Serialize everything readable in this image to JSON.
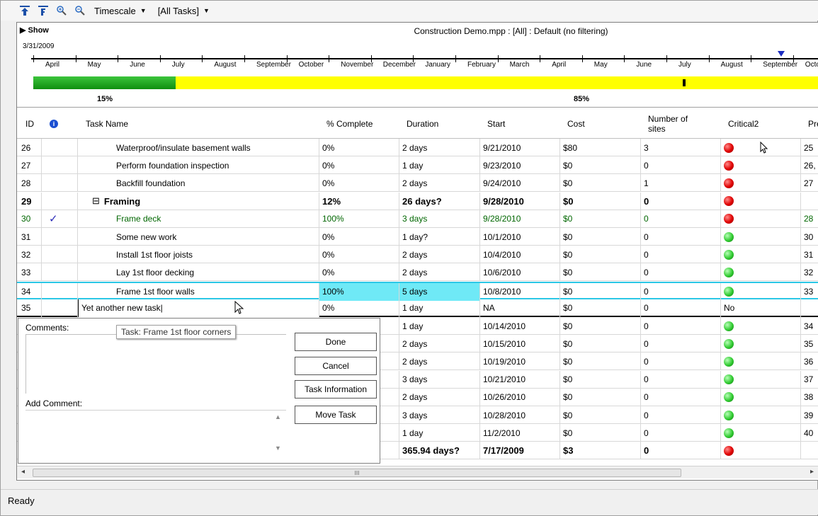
{
  "toolbar": {
    "timescale_label": "Timescale",
    "filter_label": "[All Tasks]"
  },
  "timeline": {
    "show_label": "Show",
    "title": "Construction Demo.mpp : [All] : Default (no filtering)",
    "start_date": "3/31/2009",
    "months": [
      "April",
      "May",
      "June",
      "July",
      "August",
      "September",
      "October",
      "November",
      "December",
      "January",
      "February",
      "March",
      "April",
      "May",
      "June",
      "July",
      "August",
      "September",
      "Octo"
    ],
    "complete_pct_label": "15%",
    "remaining_pct_label": "85%",
    "complete_fraction": 0.15,
    "colors": {
      "complete": "#1a9e1a",
      "remaining": "#ffff00",
      "marker": "#1b2cc1"
    }
  },
  "grid": {
    "headers": {
      "id": "ID",
      "task_name": "Task Name",
      "pct_complete": "% Complete",
      "duration": "Duration",
      "start": "Start",
      "cost": "Cost",
      "sites_line1": "Number of",
      "sites_line2": "sites",
      "critical": "Critical2",
      "pred": "Pre"
    },
    "rows": [
      {
        "id": "26",
        "name": "Waterproof/insulate basement walls",
        "pct": "0%",
        "duration": "2 days",
        "start": "9/21/2010",
        "cost": "$80",
        "sites": "3",
        "critical": "red",
        "pred": "25"
      },
      {
        "id": "27",
        "name": "Perform foundation inspection",
        "pct": "0%",
        "duration": "1 day",
        "start": "9/23/2010",
        "cost": "$0",
        "sites": "0",
        "critical": "red",
        "pred": "26,"
      },
      {
        "id": "28",
        "name": "Backfill foundation",
        "pct": "0%",
        "duration": "2 days",
        "start": "9/24/2010",
        "cost": "$0",
        "sites": "1",
        "critical": "red",
        "pred": "27"
      },
      {
        "id": "29",
        "name": "Framing",
        "pct": "12%",
        "duration": "26 days?",
        "start": "9/28/2010",
        "cost": "$0",
        "sites": "0",
        "critical": "red",
        "pred": ""
      },
      {
        "id": "30",
        "name": "Frame deck",
        "pct": "100%",
        "duration": "3 days",
        "start": "9/28/2010",
        "cost": "$0",
        "sites": "0",
        "critical": "red",
        "pred": "28"
      },
      {
        "id": "31",
        "name": "Some new work",
        "pct": "0%",
        "duration": "1 day?",
        "start": "10/1/2010",
        "cost": "$0",
        "sites": "0",
        "critical": "green",
        "pred": "30"
      },
      {
        "id": "32",
        "name": "Install 1st floor joists",
        "pct": "0%",
        "duration": "2 days",
        "start": "10/4/2010",
        "cost": "$0",
        "sites": "0",
        "critical": "green",
        "pred": "31"
      },
      {
        "id": "33",
        "name": "Lay 1st floor decking",
        "pct": "0%",
        "duration": "2 days",
        "start": "10/6/2010",
        "cost": "$0",
        "sites": "0",
        "critical": "green",
        "pred": "32"
      },
      {
        "id": "34",
        "name": "Frame 1st floor walls",
        "pct": "100%",
        "duration": "5 days",
        "start": "10/8/2010",
        "cost": "$0",
        "sites": "0",
        "critical": "green",
        "pred": "33"
      },
      {
        "id": "35",
        "name": "Yet another new task",
        "pct": "0%",
        "duration": "1 day",
        "start": "NA",
        "cost": "$0",
        "sites": "0",
        "critical": "No",
        "pred": ""
      },
      {
        "id": "",
        "name": "",
        "pct": "",
        "duration": "1 day",
        "start": "10/14/2010",
        "cost": "$0",
        "sites": "0",
        "critical": "green",
        "pred": "34"
      },
      {
        "id": "",
        "name": "",
        "pct": "",
        "duration": "2 days",
        "start": "10/15/2010",
        "cost": "$0",
        "sites": "0",
        "critical": "green",
        "pred": "35"
      },
      {
        "id": "",
        "name": "",
        "pct": "",
        "duration": "2 days",
        "start": "10/19/2010",
        "cost": "$0",
        "sites": "0",
        "critical": "green",
        "pred": "36"
      },
      {
        "id": "",
        "name": "",
        "pct": "",
        "duration": "3 days",
        "start": "10/21/2010",
        "cost": "$0",
        "sites": "0",
        "critical": "green",
        "pred": "37"
      },
      {
        "id": "",
        "name": "",
        "pct": "",
        "duration": "2 days",
        "start": "10/26/2010",
        "cost": "$0",
        "sites": "0",
        "critical": "green",
        "pred": "38"
      },
      {
        "id": "",
        "name": "",
        "pct": "",
        "duration": "3 days",
        "start": "10/28/2010",
        "cost": "$0",
        "sites": "0",
        "critical": "green",
        "pred": "39"
      },
      {
        "id": "",
        "name": "",
        "pct": "",
        "duration": "1 day",
        "start": "11/2/2010",
        "cost": "$0",
        "sites": "0",
        "critical": "green",
        "pred": "40"
      },
      {
        "id": "",
        "name": "",
        "pct": "",
        "duration": "365.94 days?",
        "start": "7/17/2009",
        "cost": "$3",
        "sites": "0",
        "critical": "red",
        "pred": ""
      }
    ]
  },
  "popup": {
    "comments_label": "Comments:",
    "tooltip": "Task: Frame 1st floor corners",
    "add_comment_label": "Add Comment:",
    "buttons": {
      "done": "Done",
      "cancel": "Cancel",
      "task_info": "Task Information",
      "move_task": "Move Task"
    }
  },
  "scrollbar": {
    "grip": "III"
  },
  "status": {
    "text": "Ready"
  }
}
